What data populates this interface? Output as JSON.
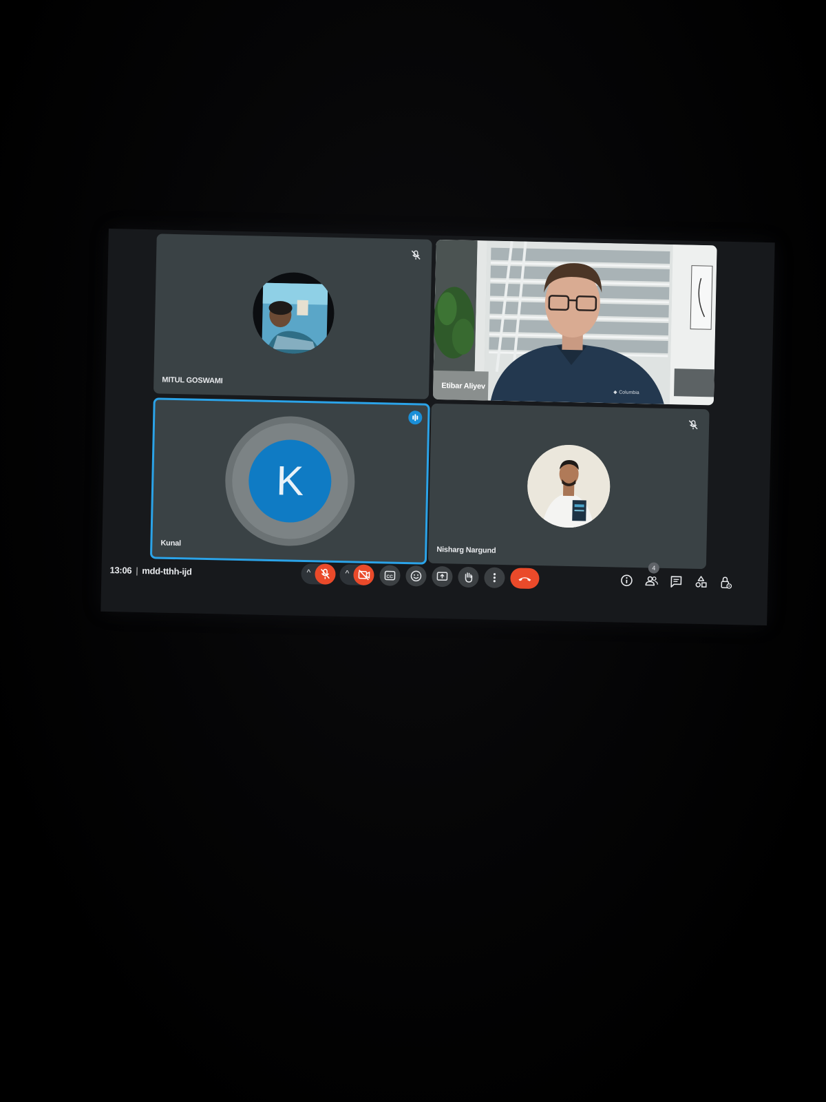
{
  "meeting": {
    "time": "13:06",
    "separator": "|",
    "code": "mdd-tthh-ijd"
  },
  "participants": [
    {
      "name": "MITUL GOSWAMI",
      "muted": true,
      "speaking": false,
      "avatar": "photo"
    },
    {
      "name": "Etibar Aliyev",
      "muted": false,
      "speaking": false,
      "avatar": "video"
    },
    {
      "name": "Kunal",
      "muted": false,
      "speaking": true,
      "avatar_letter": "K",
      "avatar_color": "#0f7bc4"
    },
    {
      "name": "Nisharg Nargund",
      "muted": true,
      "speaking": false,
      "avatar": "photo"
    }
  ],
  "etibar_video_shirt_text": "Columbia",
  "controls": {
    "mic": "mic-off-icon",
    "camera": "camera-off-icon",
    "captions": "captions-icon",
    "reactions": "emoji-icon",
    "present": "present-screen-icon",
    "raise_hand": "raise-hand-icon",
    "more": "more-options-icon",
    "leave": "end-call-icon"
  },
  "right_panel": {
    "people_count": "4"
  },
  "colors": {
    "accent": "#2ba3e8",
    "danger": "#ea4a2a",
    "tile_bg": "#3a4245",
    "avatar_k": "#0f7bc4"
  }
}
